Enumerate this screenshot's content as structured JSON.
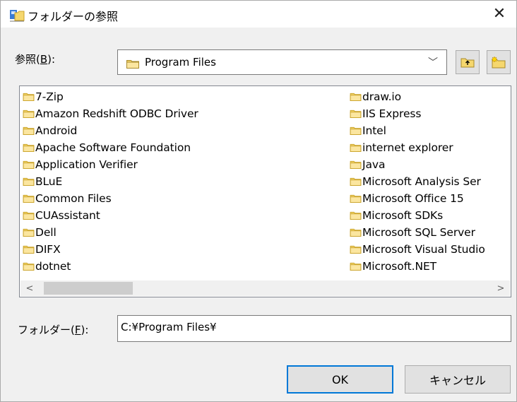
{
  "window": {
    "title": "フォルダーの参照",
    "close_glyph": "✕"
  },
  "lookin": {
    "label_prefix": "参照(",
    "label_key": "B",
    "label_suffix": "):",
    "value": "Program Files",
    "dropdown_glyph": "﹀"
  },
  "folders_left": [
    "7-Zip",
    "Amazon Redshift ODBC Driver",
    "Android",
    "Apache Software Foundation",
    "Application Verifier",
    "BLuE",
    "Common Files",
    "CUAssistant",
    "Dell",
    "DIFX",
    "dotnet"
  ],
  "folders_right": [
    "draw.io",
    "IIS Express",
    "Intel",
    "internet explorer",
    "Java",
    "Microsoft Analysis Ser",
    "Microsoft Office 15",
    "Microsoft SDKs",
    "Microsoft SQL Server",
    "Microsoft Visual Studio",
    "Microsoft.NET"
  ],
  "scroll": {
    "left_glyph": "<",
    "right_glyph": ">"
  },
  "folder_field": {
    "label_prefix": "フォルダー(",
    "label_key": "F",
    "label_suffix": "):",
    "value": "C:¥Program Files¥"
  },
  "buttons": {
    "ok": "OK",
    "cancel": "キャンセル"
  },
  "colors": {
    "folder_fill": "#f5d76e",
    "folder_edge": "#c9a227",
    "accent": "#0078d7"
  }
}
